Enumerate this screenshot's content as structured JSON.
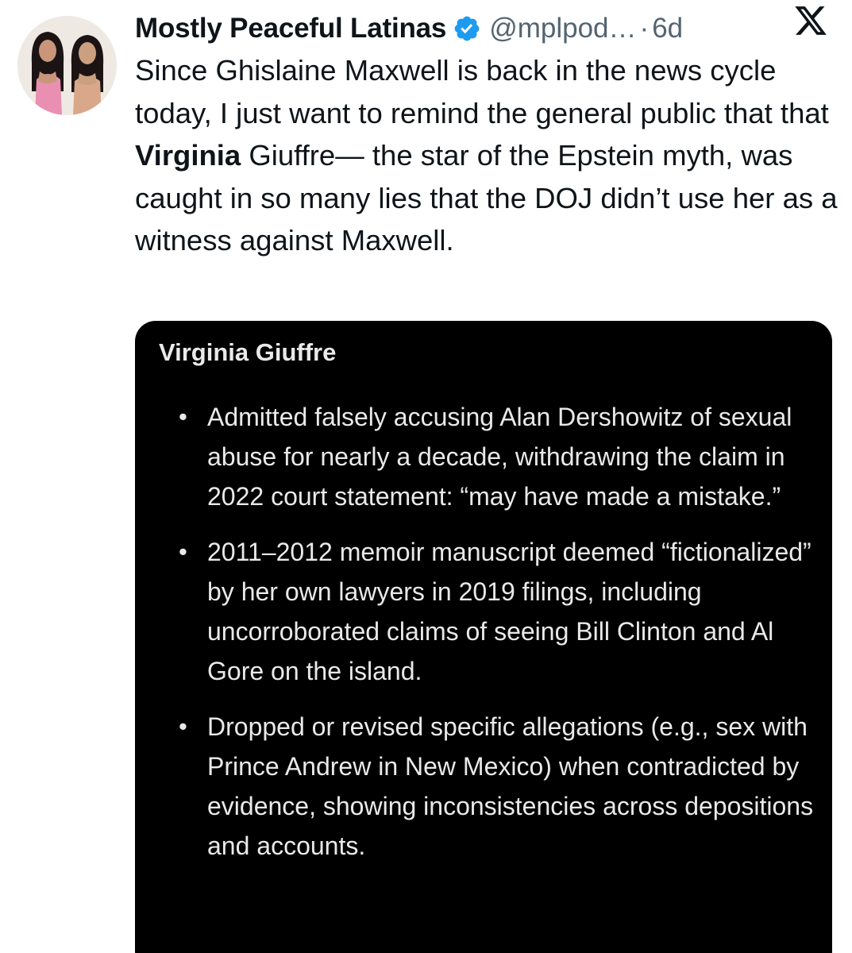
{
  "author": {
    "display_name": "Mostly Peaceful Latinas",
    "handle": "@mplpod…",
    "separator": "·",
    "time": "6d",
    "verified": true
  },
  "tweet": {
    "text_before_bold": "Since Ghislaine Maxwell is back in the news cycle today, I just want to remind the general public that that ",
    "bold_text": "Virginia",
    "text_after_bold": " Giuffre— the star of the Epstein myth, was caught in so many lies that the DOJ didn’t use her as a witness against Maxwell."
  },
  "card": {
    "title": "Virginia Giuffre",
    "bullet_mark": "•",
    "bullets": [
      "Admitted falsely accusing Alan Dershowitz of sexual abuse for nearly a decade, withdrawing the claim in 2022 court statement: “may have made a mistake.”",
      "2011–2012 memoir manuscript deemed “fictionalized” by her own lawyers in 2019 filings, including uncorroborated claims of seeing Bill Clinton and Al Gore on the island.",
      "Dropped or revised specific allegations (e.g., sex with Prince Andrew in New Mexico) when contradicted by evidence, showing inconsistencies across depositions and accounts."
    ]
  },
  "icons": {
    "verified_badge": "verified-badge-icon",
    "platform_logo": "x-logo-icon"
  },
  "colors": {
    "text_primary": "#0f1419",
    "text_secondary": "#536471",
    "verified_blue": "#1d9bf0",
    "card_background": "#000000",
    "card_text": "#e9e9ea"
  }
}
